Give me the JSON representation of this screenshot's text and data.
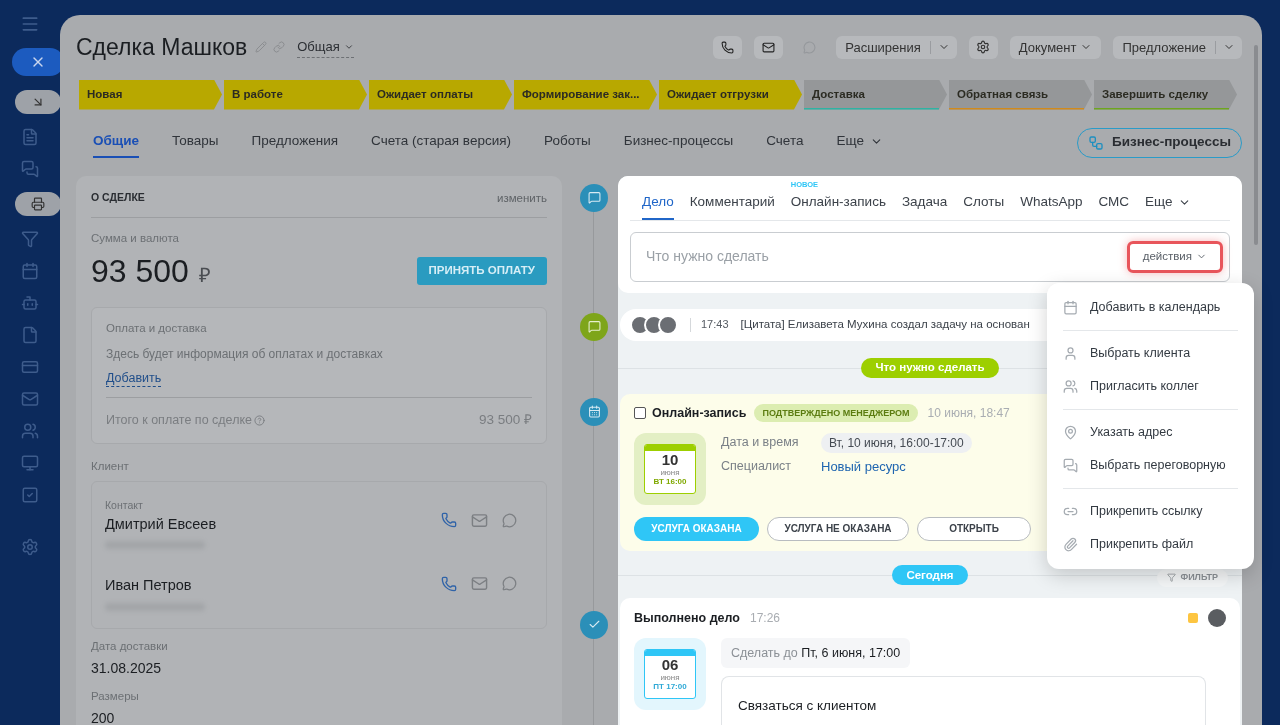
{
  "header": {
    "title": "Сделка Машков",
    "category": "Общая",
    "icon_buttons": [
      {
        "kind": "phone",
        "disabled": false
      },
      {
        "kind": "mail",
        "disabled": false
      },
      {
        "kind": "chat",
        "disabled": true
      }
    ],
    "menus": [
      {
        "label": "Расширения",
        "kind": "split"
      },
      {
        "kind": "gear"
      },
      {
        "label": "Документ",
        "kind": "dropdown"
      },
      {
        "label": "Предложение",
        "kind": "split"
      }
    ]
  },
  "stages": [
    {
      "label": "Новая",
      "reached": true,
      "color": "#b8a800"
    },
    {
      "label": "В работе",
      "reached": true,
      "color": "#b8a800"
    },
    {
      "label": "Ожидает оплаты",
      "reached": true,
      "color": "#b8a800"
    },
    {
      "label": "Формирование зак...",
      "reached": true,
      "color": "#b8a800"
    },
    {
      "label": "Ожидает отгрузки",
      "reached": true,
      "color": "#b8a800"
    },
    {
      "label": "Доставка",
      "reached": false,
      "color": "#2fb3a3"
    },
    {
      "label": "Обратная связь",
      "reached": false,
      "color": "#d08a1c"
    },
    {
      "label": "Завершить сделку",
      "reached": false,
      "color": "#6ea51f"
    }
  ],
  "tabs": [
    {
      "label": "Общие",
      "selected": true,
      "kind": "tab"
    },
    {
      "label": "Товары",
      "selected": false,
      "kind": "tab"
    },
    {
      "label": "Предложения",
      "selected": false,
      "kind": "tab"
    },
    {
      "label": "Счета (старая версия)",
      "selected": false,
      "kind": "tab"
    },
    {
      "label": "Роботы",
      "selected": false,
      "kind": "tab"
    },
    {
      "label": "Бизнес-процессы",
      "selected": false,
      "kind": "tab"
    },
    {
      "label": "Счета",
      "selected": false,
      "kind": "tab"
    },
    {
      "label": "Еще",
      "selected": false,
      "kind": "more"
    }
  ],
  "bp_button": "Бизнес-процессы",
  "deal": {
    "title": "О СДЕЛКЕ",
    "edit": "изменить",
    "amount_label": "Сумма и валюта",
    "amount": "93 500",
    "currency": "₽",
    "pay_button": "ПРИНЯТЬ ОПЛАТУ",
    "payments": {
      "title": "Оплата и доставка",
      "text": "Здесь будет информация об оплатах и доставках",
      "add": "Добавить",
      "total_label": "Итого к оплате по сделке",
      "total": "93 500 ₽"
    },
    "client_label": "Клиент",
    "contacts": [
      {
        "label": "Контакт",
        "name": "Дмитрий Евсеев"
      },
      {
        "name": "Иван Петров"
      }
    ],
    "fields": [
      {
        "label": "Дата доставки",
        "value": "31.08.2025"
      },
      {
        "label": "Размеры",
        "value": "200"
      }
    ]
  },
  "editor": {
    "tabs": [
      {
        "label": "Дело",
        "selected": true,
        "kind": "tab"
      },
      {
        "label": "Комментарий",
        "selected": false,
        "kind": "tab"
      },
      {
        "label": "Онлайн-запись",
        "selected": false,
        "kind": "tab",
        "badge": "НОВОЕ"
      },
      {
        "label": "Задача",
        "selected": false,
        "kind": "tab"
      },
      {
        "label": "Слоты",
        "selected": false,
        "kind": "tab"
      },
      {
        "label": "WhatsApp",
        "selected": false,
        "kind": "tab"
      },
      {
        "label": "СМС",
        "selected": false,
        "kind": "tab"
      },
      {
        "label": "Еще",
        "selected": false,
        "kind": "more"
      }
    ],
    "placeholder": "Что нужно сделать",
    "actions": "действия"
  },
  "actions_menu": [
    [
      {
        "label": "Добавить в календарь",
        "kind": "calendar"
      }
    ],
    [
      {
        "label": "Выбрать клиента",
        "kind": "person"
      },
      {
        "label": "Пригласить коллег",
        "kind": "people"
      }
    ],
    [
      {
        "label": "Указать адрес",
        "kind": "pin"
      },
      {
        "label": "Выбрать переговорную",
        "kind": "room"
      }
    ],
    [
      {
        "label": "Прикрепить ссылку",
        "kind": "link"
      },
      {
        "label": "Прикрепить файл",
        "kind": "clip"
      }
    ]
  ],
  "comment": {
    "time": "17:43",
    "text": "[Цитата] Елизавета Мухина создал задачу на основан"
  },
  "todo_label": "Что нужно сделать",
  "booking": {
    "checked": false,
    "title": "Онлайн-запись",
    "status": "ПОДТВЕРЖДЕНО МЕНЕДЖЕРОМ",
    "created": "10 июня, 18:47",
    "calendar": {
      "day": "10",
      "month": "июня",
      "weekday_time": "ВТ 16:00"
    },
    "details": [
      {
        "label": "Дата и время",
        "value": "Вт, 10 июня, 16:00-17:00",
        "kind": "chip"
      },
      {
        "label": "Специалист",
        "value": "Новый ресурс",
        "kind": "link"
      }
    ],
    "buttons": [
      {
        "label": "УСЛУГА ОКАЗАНА",
        "kind": "primary"
      },
      {
        "label": "УСЛУГА НЕ ОКАЗАНА",
        "kind": "outline"
      },
      {
        "label": "ОТКРЫТЬ",
        "kind": "outline"
      }
    ]
  },
  "today_label": "Сегодня",
  "filter": "ФИЛЬТР",
  "done": {
    "title": "Выполнено дело",
    "time": "17:26",
    "calendar": {
      "day": "06",
      "month": "июня",
      "weekday_time": "ПТ 17:00"
    },
    "deadline": "Сделать до **Пт, 6 июня, 17:00**",
    "text": "Связаться с клиентом"
  }
}
